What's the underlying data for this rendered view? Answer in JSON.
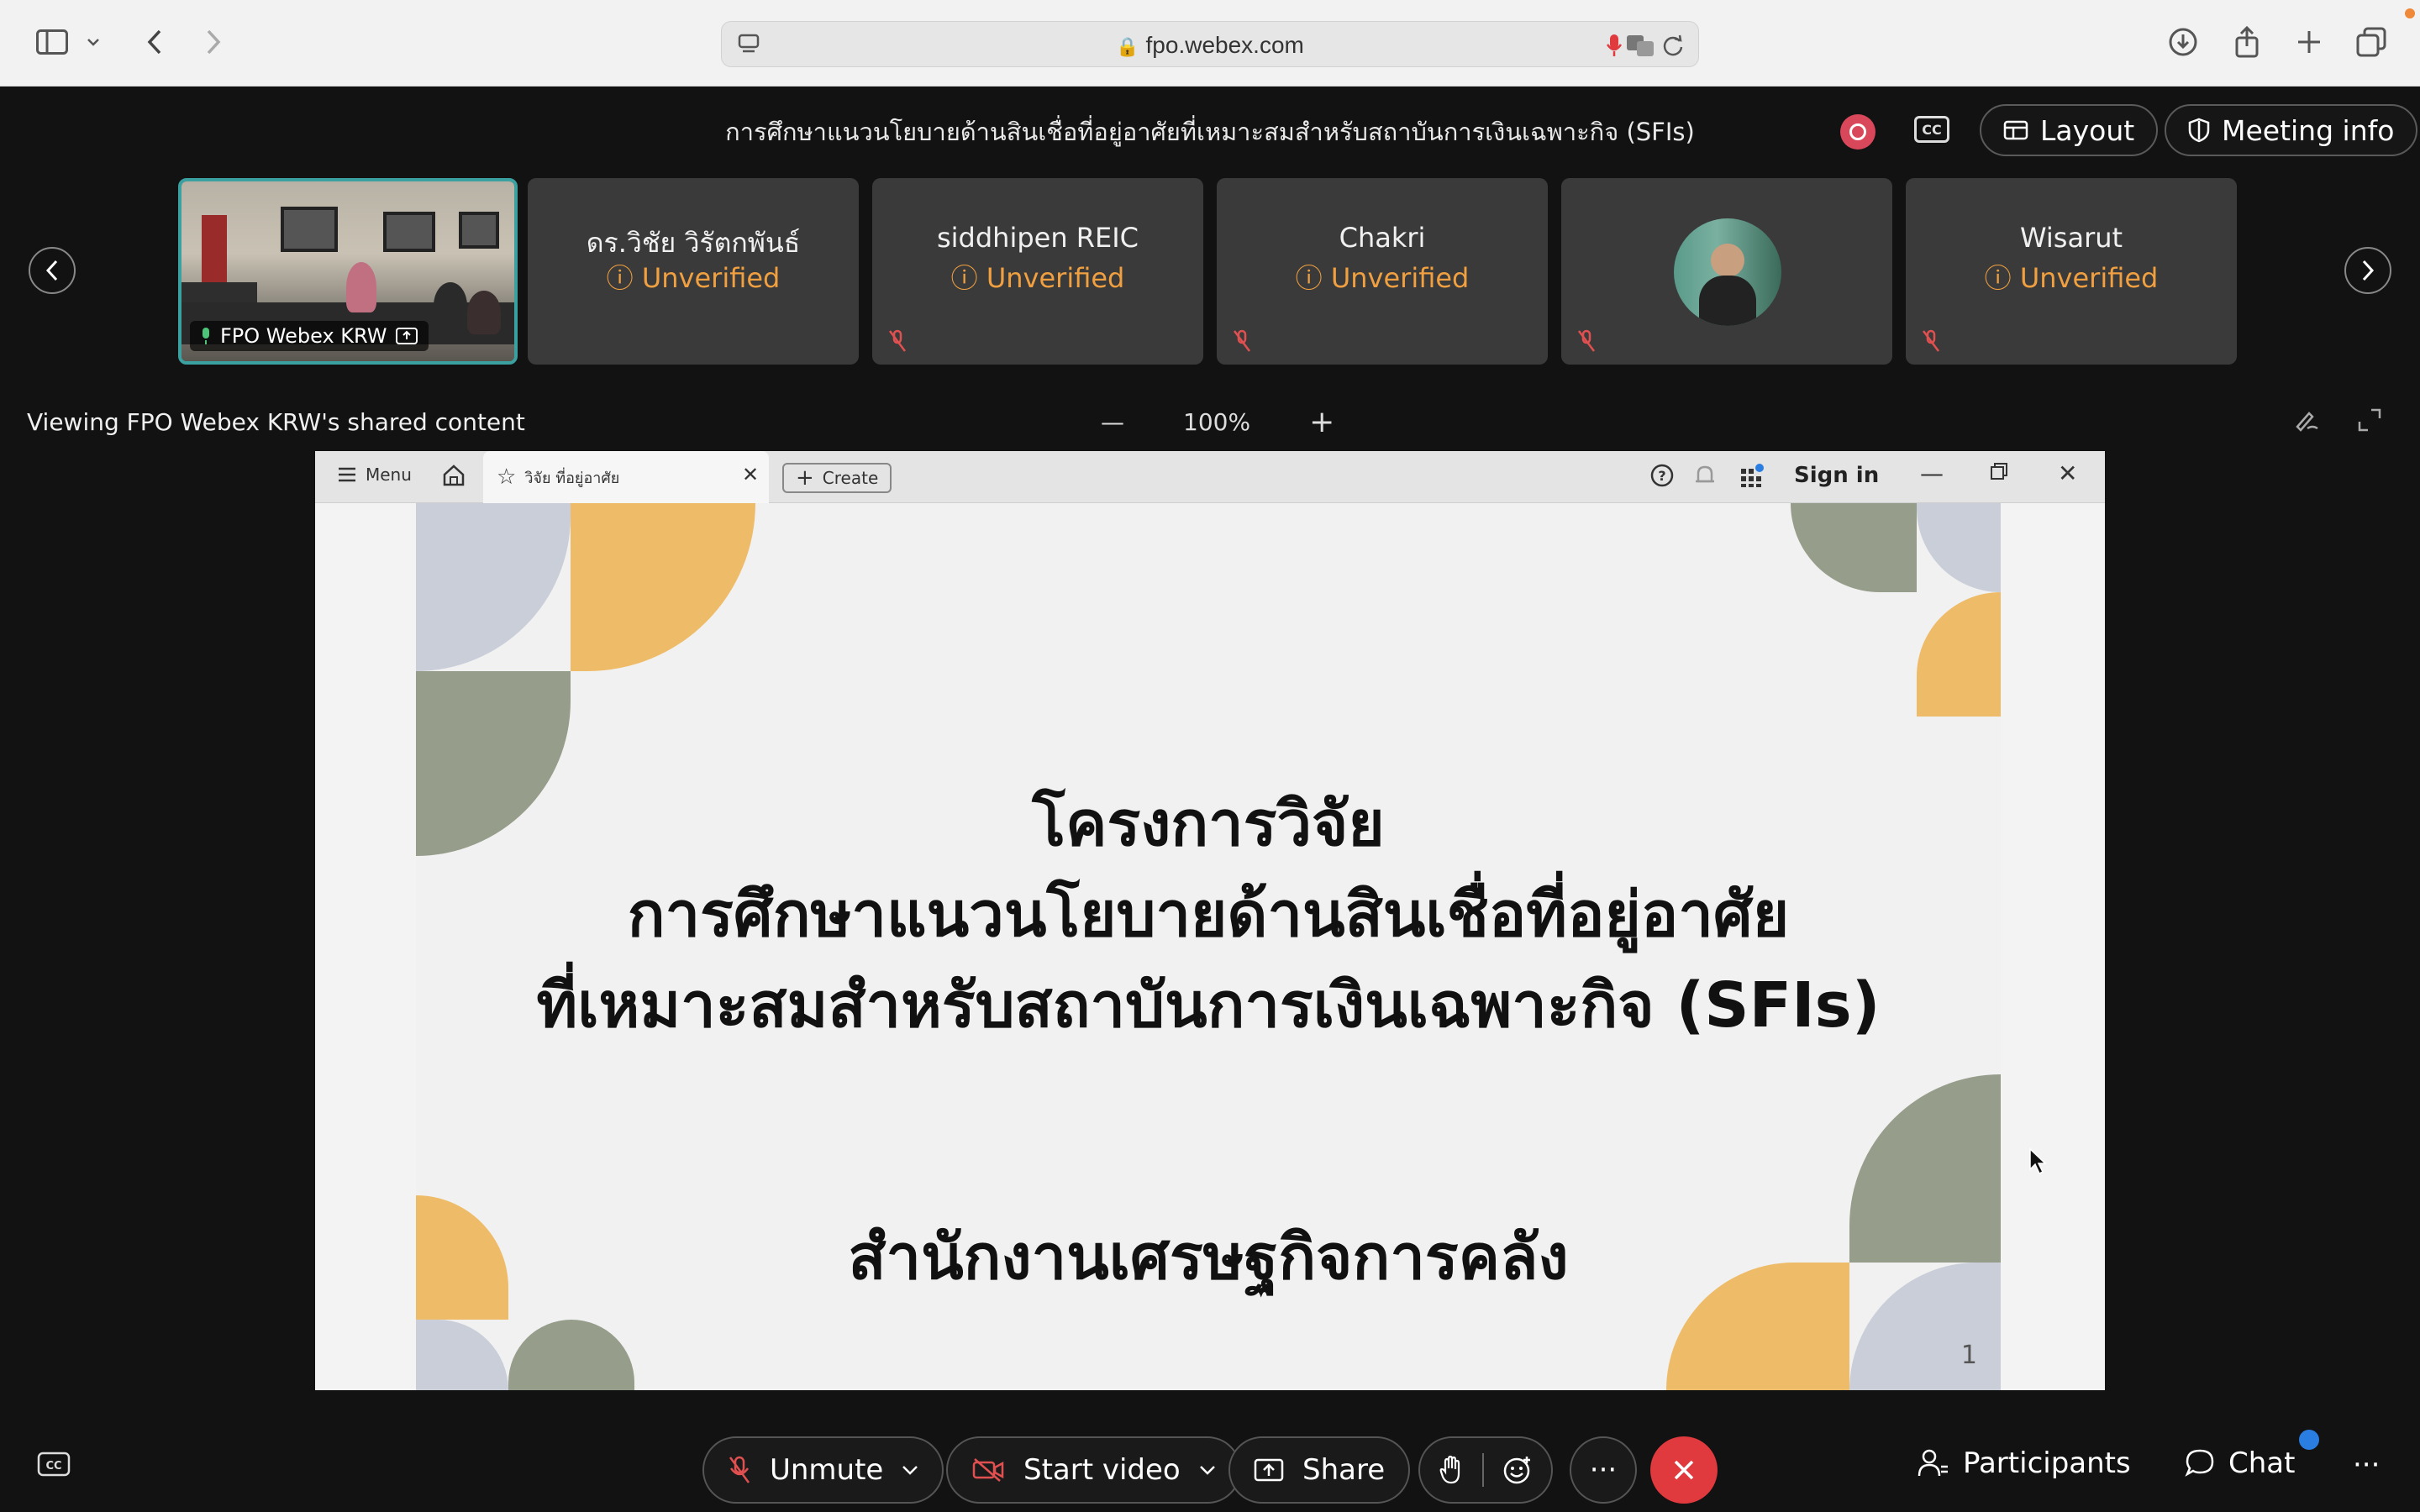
{
  "browser": {
    "url": "fpo.webex.com"
  },
  "meeting": {
    "title": "การศึกษาแนวนโยบายด้านสินเชื่อที่อยู่อาศัยที่เหมาะสมสำหรับสถาบันการเงินเฉพาะกิจ (SFIs)",
    "cc_label": "CC",
    "layout_label": "Layout",
    "meeting_info_label": "Meeting info"
  },
  "participants": [
    {
      "name": "FPO Webex KRW",
      "status": ""
    },
    {
      "name": "ดร.วิชัย วิรัตกพันธ์",
      "status": "Unverified"
    },
    {
      "name": "siddhipen REIC",
      "status": "Unverified"
    },
    {
      "name": "Chakri",
      "status": "Unverified"
    },
    {
      "name": "",
      "status": ""
    },
    {
      "name": "Wisarut",
      "status": "Unverified"
    }
  ],
  "share": {
    "viewing_text": "Viewing FPO Webex KRW's shared content",
    "zoom_level": "100%"
  },
  "shared_browser": {
    "menu_label": "Menu",
    "tab_label": "วิจัย ที่อยู่อาศัย",
    "create_label": "Create",
    "sign_in_label": "Sign in"
  },
  "slide": {
    "line1": "โครงการวิจัย",
    "line2": "การศึกษาแนวนโยบายด้านสินเชื่อที่อยู่อาศัย",
    "line3": "ที่เหมาะสมสำหรับสถาบันการเงินเฉพาะกิจ (SFIs)",
    "org": "สำนักงานเศรษฐกิจการคลัง",
    "page_number": "1",
    "colors": {
      "gray": "#c9ced8",
      "yellow": "#eebc68",
      "green": "#969d8a"
    }
  },
  "controls": {
    "unmute_label": "Unmute",
    "start_video_label": "Start video",
    "share_label": "Share",
    "more_label": "···",
    "participants_label": "Participants",
    "chat_label": "Chat"
  }
}
